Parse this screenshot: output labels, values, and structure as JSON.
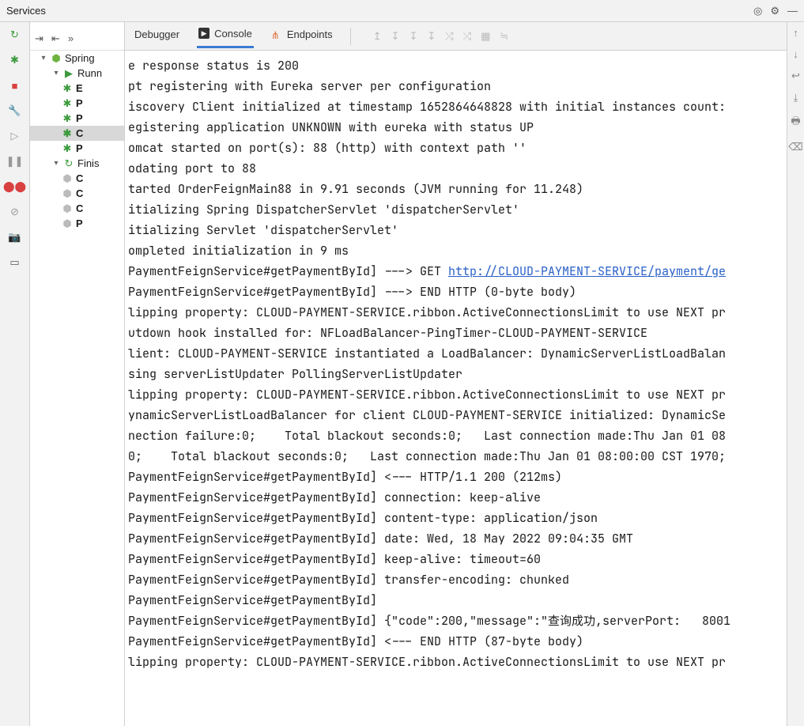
{
  "window": {
    "title": "Services"
  },
  "tabs": {
    "debugger": "Debugger",
    "console": "Console",
    "endpoints": "Endpoints"
  },
  "tree": {
    "root": "Spring",
    "running": "Runn",
    "running_children": [
      "E",
      "P",
      "P",
      "C",
      "P"
    ],
    "finished": "Finis",
    "finished_children": [
      "C",
      "C",
      "C",
      "P"
    ]
  },
  "console_lines": [
    {
      "text": "e response status is 200"
    },
    {
      "text": "pt registering with Eureka server per configuration"
    },
    {
      "text": "iscovery Client initialized at timestamp 1652864648828 with initial instances count:"
    },
    {
      "text": "egistering application UNKNOWN with eureka with status UP"
    },
    {
      "text": "omcat started on port(s): 88 (http) with context path ''"
    },
    {
      "text": "odating port to 88"
    },
    {
      "text": "tarted OrderFeignMain88 in 9.91 seconds (JVM running for 11.248)"
    },
    {
      "text": "itializing Spring DispatcherServlet 'dispatcherServlet'"
    },
    {
      "text": "itializing Servlet 'dispatcherServlet'"
    },
    {
      "text": "ompleted initialization in 9 ms"
    },
    {
      "text": "PaymentFeignService#getPaymentById] ---> GET ",
      "link": "http://CLOUD-PAYMENT-SERVICE/payment/ge"
    },
    {
      "text": "PaymentFeignService#getPaymentById] ---> END HTTP (0-byte body)"
    },
    {
      "text": "lipping property: CLOUD-PAYMENT-SERVICE.ribbon.ActiveConnectionsLimit to use NEXT pr"
    },
    {
      "text": "utdown hook installed for: NFLoadBalancer-PingTimer-CLOUD-PAYMENT-SERVICE"
    },
    {
      "text": "lient: CLOUD-PAYMENT-SERVICE instantiated a LoadBalancer: DynamicServerListLoadBalan"
    },
    {
      "text": "sing serverListUpdater PollingServerListUpdater"
    },
    {
      "text": "lipping property: CLOUD-PAYMENT-SERVICE.ribbon.ActiveConnectionsLimit to use NEXT pr"
    },
    {
      "text": "ynamicServerListLoadBalancer for client CLOUD-PAYMENT-SERVICE initialized: DynamicSe"
    },
    {
      "text": "nection failure:0;    Total blackout seconds:0;   Last connection made:Thu Jan 01 08"
    },
    {
      "text": "0;    Total blackout seconds:0;   Last connection made:Thu Jan 01 08:00:00 CST 1970;"
    },
    {
      "text": ""
    },
    {
      "text": "PaymentFeignService#getPaymentById] <--- HTTP/1.1 200 (212ms)"
    },
    {
      "text": "PaymentFeignService#getPaymentById] connection: keep-alive"
    },
    {
      "text": "PaymentFeignService#getPaymentById] content-type: application/json"
    },
    {
      "text": "PaymentFeignService#getPaymentById] date: Wed, 18 May 2022 09:04:35 GMT"
    },
    {
      "text": "PaymentFeignService#getPaymentById] keep-alive: timeout=60"
    },
    {
      "text": "PaymentFeignService#getPaymentById] transfer-encoding: chunked"
    },
    {
      "text": "PaymentFeignService#getPaymentById]"
    },
    {
      "text": "PaymentFeignService#getPaymentById] {\"code\":200,\"message\":\"查询成功,serverPort:   8001"
    },
    {
      "text": "PaymentFeignService#getPaymentById] <--- END HTTP (87-byte body)"
    },
    {
      "text": "lipping property: CLOUD-PAYMENT-SERVICE.ribbon.ActiveConnectionsLimit to use NEXT pr"
    }
  ]
}
